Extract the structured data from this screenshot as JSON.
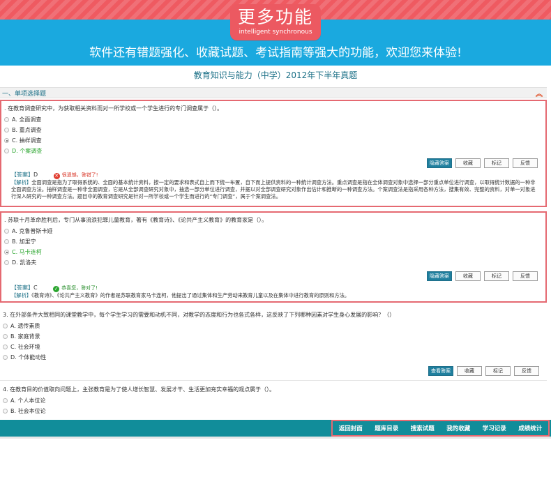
{
  "banner": {
    "title": "更多功能",
    "subtitle": "intelligent synchronous",
    "slogan": "软件还有错题强化、收藏试题、考试指南等强大的功能，欢迎您来体验!"
  },
  "exam_title": "教育知识与能力（中学）2012年下半年真题",
  "section": {
    "label": "一、单项选择题",
    "collapse_icon": "double-chevron-up-icon"
  },
  "buttons": {
    "hide_answer": "隐藏答案",
    "show_answer": "查看答案",
    "favorite": "收藏",
    "mark": "标记",
    "feedback": "反馈"
  },
  "labels": {
    "answer_tag": "【答案】",
    "analysis_tag": "【解析】"
  },
  "questions": [
    {
      "stem": ". 在教育调查研究中，为获取相关资料而对一所学校或一个学生进行的专门调查属于（）。",
      "options": [
        "A. 全面调查",
        "B. 重点调查",
        "C. 抽样调查",
        "D. 个案调查"
      ],
      "answer": "D",
      "verdict": "很遗憾，答错了!",
      "analysis": "全面调查是指为了取得系统的、全面的基本统计资料，按一定的要求和表式自上而下统一布置，自下而上提供资料的一种统计调查方法。重点调查是指在全体调查对象中选择一部分重点单位进行调查，以取得统计数据的一种非全面调查方法。抽样调查是一种非全面调查，它是从全部调查研究对象中，抽选一部分单位进行调查，并据以对全部调查研究对象作出估计和推断的一种调查方法。个案调查法是指采用各种方法，搜集有效、完整的资料，对单一对象进行深入研究的一种调查方法。题目中的教育调查研究是针对一所学校或一个学生而进行的“专门调查”，属于个案调查法。"
    },
    {
      "stem": ". 苏联十月革命胜利后，专门从事流浪犯罪儿童教育，著有《教育诗》、《论共产主义教育》的教育家是（）。",
      "options": [
        "A. 克鲁普斯卡娅",
        "B. 加里宁",
        "C. 马卡连柯",
        "D. 凯洛夫"
      ],
      "answer": "C",
      "verdict": "恭喜您，答对了!",
      "analysis": "《教育诗》、《论共产主义教育》的作者是苏联教育家马卡连柯，他提出了通过集体和生产劳动来教育儿童以及在集体中进行教育的原则和方法。"
    },
    {
      "stem": "3. 在外部条件大致相同的课堂教学中，每个学生学习的需要和动机不同，对教学的态度和行为也各式各样，这反映了下列哪种因素对学生身心发展的影响？（）",
      "options": [
        "A. 遗传素质",
        "B. 家庭背景",
        "C. 社会环境",
        "D. 个体能动性"
      ]
    },
    {
      "stem": "4. 在教育目的价值取向问题上，主张教育是为了使人增长智慧、发展才干、生活更加充实幸福的观点属于（）。",
      "options": [
        "A. 个人本位论",
        "B. 社会本位论"
      ]
    }
  ],
  "bottom_nav": [
    "返回封面",
    "题库目录",
    "搜索试题",
    "我的收藏",
    "学习记录",
    "成绩统计"
  ],
  "colors": {
    "banner_blue": "#1aa9df",
    "badge_red": "#ec5961",
    "teal": "#118d9a",
    "highlight_border": "#e56971",
    "correct_green": "#2aa52e",
    "wrong_red": "#e03c2f"
  }
}
